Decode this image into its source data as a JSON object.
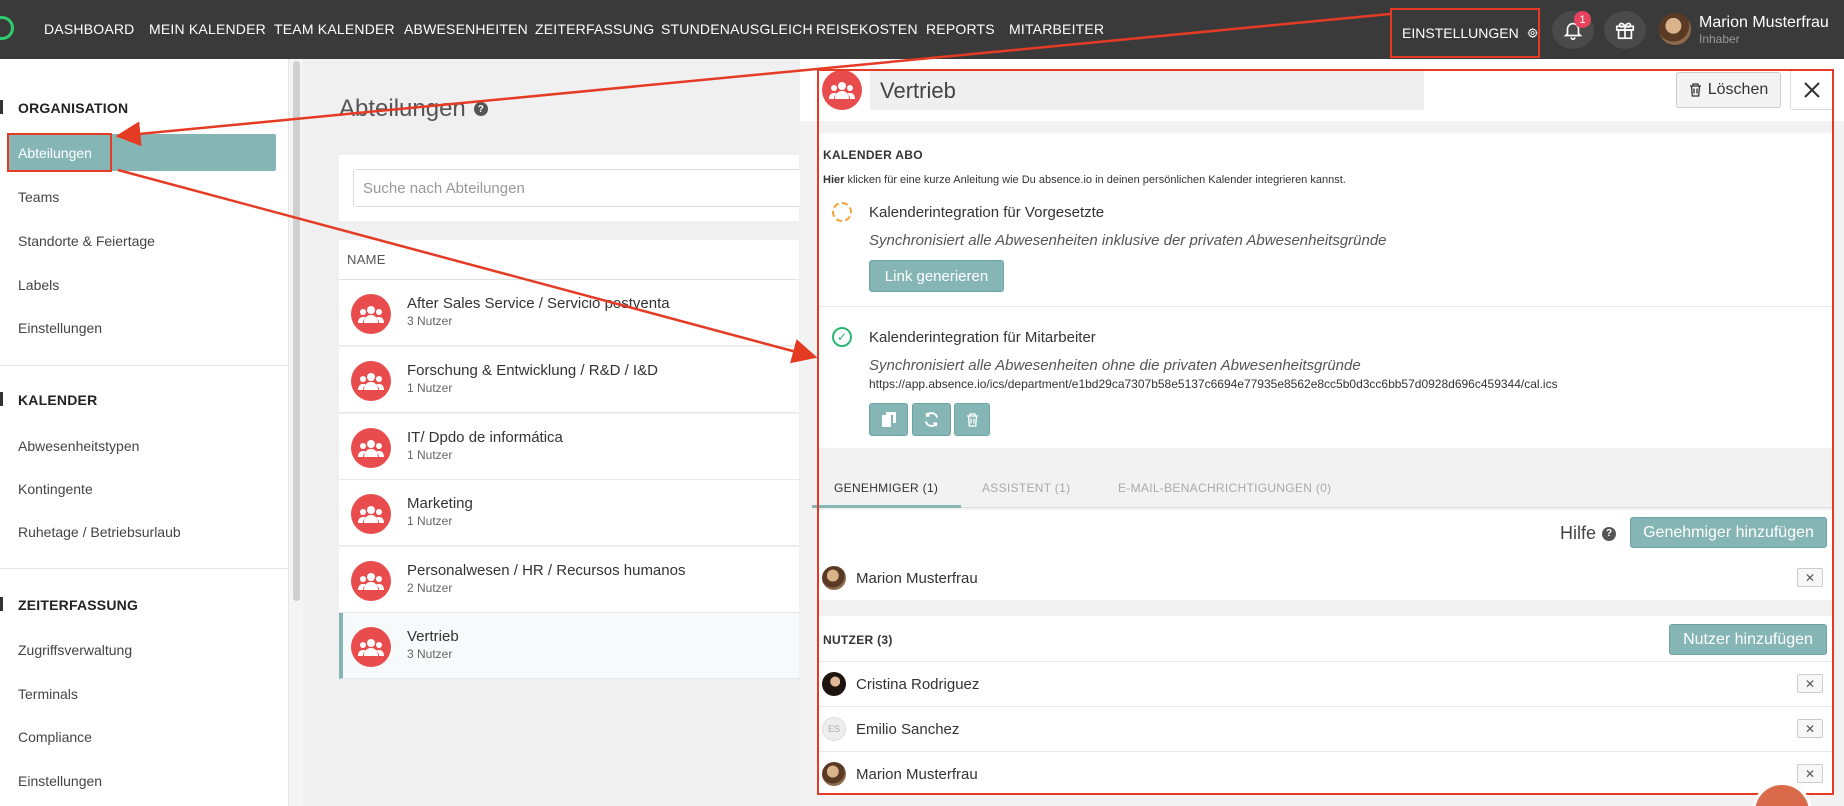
{
  "nav": {
    "items": [
      "DASHBOARD",
      "MEIN KALENDER",
      "TEAM KALENDER",
      "ABWESENHEITEN",
      "ZEITERFASSUNG",
      "STUNDENAUSGLEICH",
      "REISEKOSTEN",
      "REPORTS",
      "MITARBEITER"
    ],
    "settings_label": "EINSTELLUNGEN",
    "notification_count": "1",
    "user_name": "Marion Musterfrau",
    "user_role": "Inhaber"
  },
  "sidebar": {
    "organisation_title": "ORGANISATION",
    "organisation_items": [
      "Abteilungen",
      "Teams",
      "Standorte & Feiertage",
      "Labels",
      "Einstellungen"
    ],
    "kalender_title": "KALENDER",
    "kalender_items": [
      "Abwesenheitstypen",
      "Kontingente",
      "Ruhetage / Betriebsurlaub"
    ],
    "zeiterfassung_title": "ZEITERFASSUNG",
    "zeiterfassung_items": [
      "Zugriffsverwaltung",
      "Terminals",
      "Compliance",
      "Einstellungen"
    ]
  },
  "main": {
    "title": "Abteilungen",
    "search_placeholder": "Suche nach Abteilungen",
    "column_name": "NAME",
    "rows": [
      {
        "name": "After Sales Service / Servicio postventa",
        "count": "3 Nutzer"
      },
      {
        "name": "Forschung & Entwicklung / R&D / I&D",
        "count": "1 Nutzer"
      },
      {
        "name": "IT/ Dpdo de informática",
        "count": "1 Nutzer"
      },
      {
        "name": "Marketing",
        "count": "1 Nutzer"
      },
      {
        "name": "Personalwesen / HR / Recursos humanos",
        "count": "2 Nutzer"
      },
      {
        "name": "Vertrieb",
        "count": "3 Nutzer"
      }
    ]
  },
  "panel": {
    "title": "Vertrieb",
    "delete_label": "Löschen",
    "kalender_abo_title": "KALENDER ABO",
    "hint_bold": "Hier",
    "hint_rest": " klicken für eine kurze Anleitung wie Du absence.io in deinen persönlichen Kalender integrieren kannst.",
    "integration_manager_title": "Kalenderintegration für Vorgesetzte",
    "integration_manager_sub": "Synchronisiert alle Abwesenheiten inklusive der privaten Abwesenheitsgründe",
    "generate_link_label": "Link generieren",
    "integration_employee_title": "Kalenderintegration für Mitarbeiter",
    "integration_employee_sub": "Synchronisiert alle Abwesenheiten ohne die privaten Abwesenheitsgründe",
    "integration_employee_url": "https://app.absence.io/ics/department/e1bd29ca7307b58e5137c6694e77935e8562e8cc5b0d3cc6bb57d0928d696c459344/cal.ics",
    "tabs": [
      "GENEHMIGER  (1)",
      "ASSISTENT  (1)",
      "E-MAIL-BENACHRICHTIGUNGEN  (0)"
    ],
    "hilfe_label": "Hilfe",
    "add_approver_label": "Genehmiger hinzufügen",
    "approvers": [
      "Marion Musterfrau"
    ],
    "users_title": "NUTZER (3)",
    "add_user_label": "Nutzer hinzufügen",
    "users": [
      {
        "name": "Cristina Rodriguez",
        "initials": ""
      },
      {
        "name": "Emilio Sanchez",
        "initials": "ES"
      },
      {
        "name": "Marion Musterfrau",
        "initials": ""
      }
    ]
  },
  "colors": {
    "accent": "#86b5b6",
    "dept_icon": "#e94c4c",
    "annotation": "#e53b24",
    "topbar": "#3a3a3a"
  }
}
